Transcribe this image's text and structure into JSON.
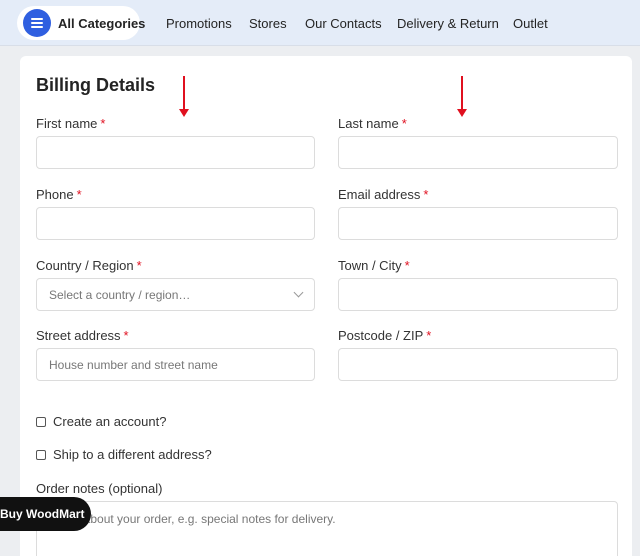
{
  "nav": {
    "categories_label": "All Categories",
    "items": [
      "Promotions",
      "Stores",
      "Our Contacts",
      "Delivery & Return",
      "Outlet"
    ]
  },
  "billing": {
    "title": "Billing Details",
    "required_mark": "*",
    "first_name_label": "First name",
    "last_name_label": "Last name",
    "phone_label": "Phone",
    "email_label": "Email address",
    "country_label": "Country / Region",
    "country_placeholder": "Select a country / region…",
    "city_label": "Town / City",
    "street_label": "Street address",
    "street_placeholder": "House number and street name",
    "postcode_label": "Postcode / ZIP",
    "create_account_label": "Create an account?",
    "ship_different_label": "Ship to a different address?",
    "order_notes_label": "Order notes (optional)",
    "order_notes_placeholder": "Notes about your order, e.g. special notes for delivery."
  },
  "floating": {
    "buy_label": "Buy WoodMart"
  },
  "colors": {
    "accent": "#2f5fe0",
    "required": "#e01020",
    "annotation_arrow": "#e0101f"
  }
}
